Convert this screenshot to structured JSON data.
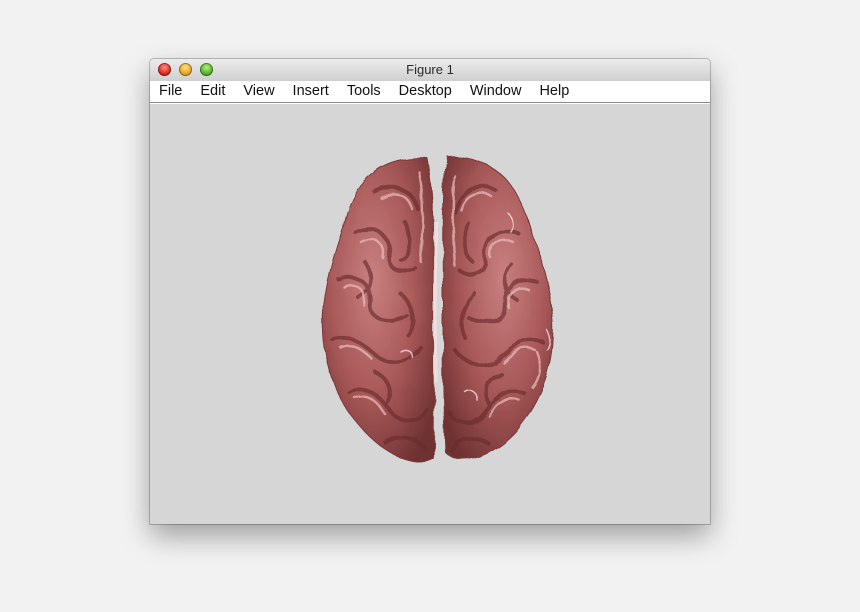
{
  "window": {
    "title": "Figure 1"
  },
  "menubar": {
    "items": [
      "File",
      "Edit",
      "View",
      "Insert",
      "Tools",
      "Desktop",
      "Window",
      "Help"
    ]
  },
  "colors": {
    "background": "#f2f2f2",
    "figure_background": "#d6d6d6",
    "brain_surface": "#b36767",
    "brain_shadow": "#6e3131",
    "brain_highlight": "#f3dede"
  },
  "icons": {
    "close": "close-icon",
    "minimize": "minimize-icon",
    "zoom": "zoom-icon",
    "surface": "brain-surface-render"
  }
}
